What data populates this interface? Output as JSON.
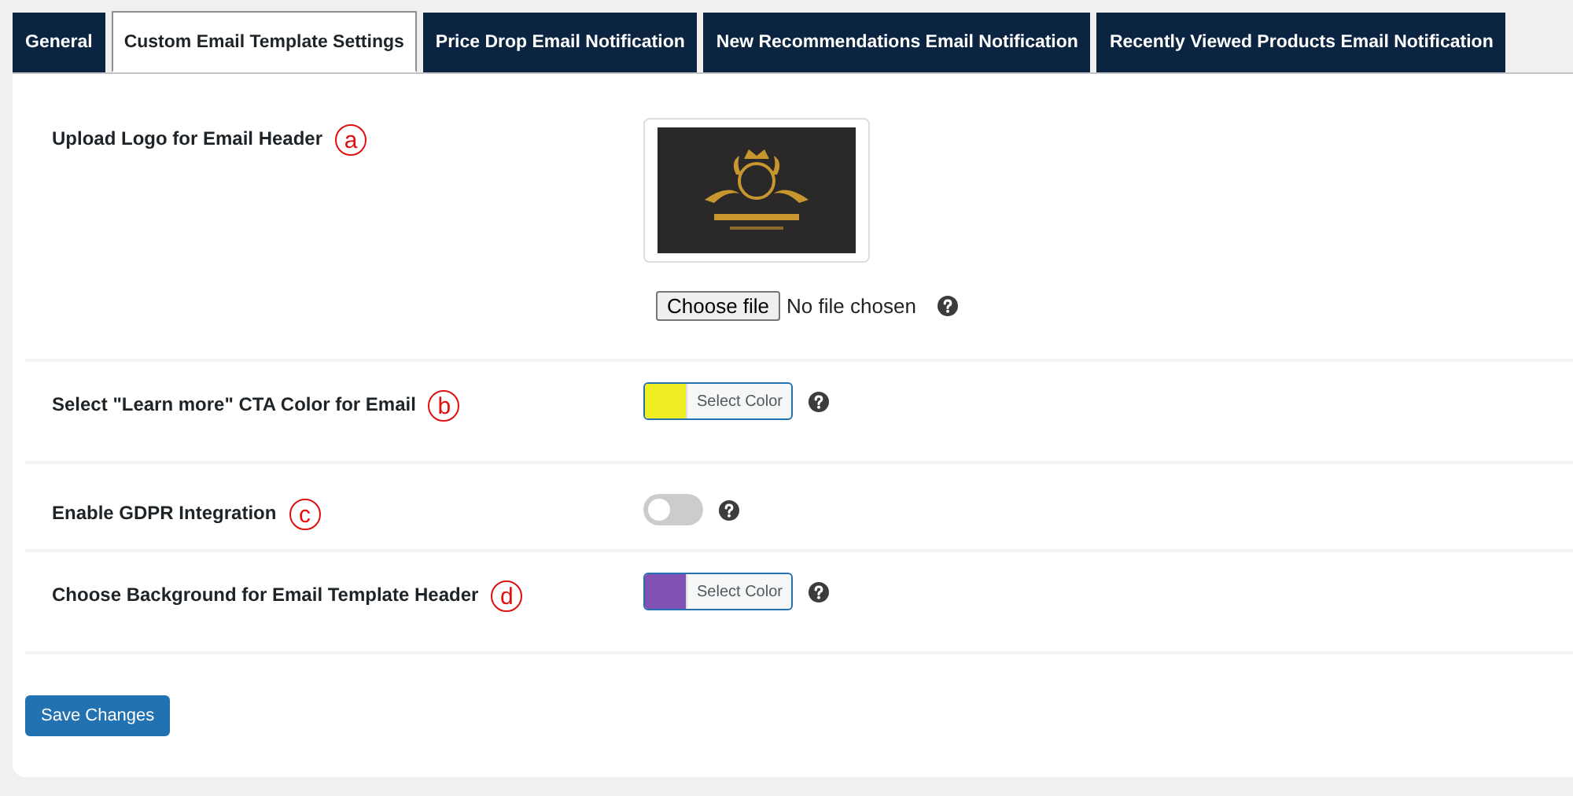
{
  "tabs": [
    {
      "label": "General",
      "selected": false
    },
    {
      "label": "Custom Email Template Settings",
      "selected": true
    },
    {
      "label": "Price Drop Email Notification",
      "selected": false
    },
    {
      "label": "New Recommendations Email Notification",
      "selected": false
    },
    {
      "label": "Recently Viewed Products Email Notification",
      "selected": false
    }
  ],
  "settings": [
    {
      "kind": "logo",
      "label": "Upload Logo for Email Header",
      "annotation": "a",
      "file_button": "Choose file",
      "file_status": "No file chosen"
    },
    {
      "kind": "color",
      "label": "Select \"Learn more\" CTA Color for Email",
      "annotation": "b",
      "color": "#eeee22",
      "button": "Select Color"
    },
    {
      "kind": "toggle",
      "label": "Enable GDPR Integration",
      "annotation": "c",
      "on": false
    },
    {
      "kind": "color",
      "label": "Choose Background for Email Template Header",
      "annotation": "d",
      "color": "#8051b3",
      "button": "Select Color"
    }
  ],
  "save_button": "Save Changes"
}
